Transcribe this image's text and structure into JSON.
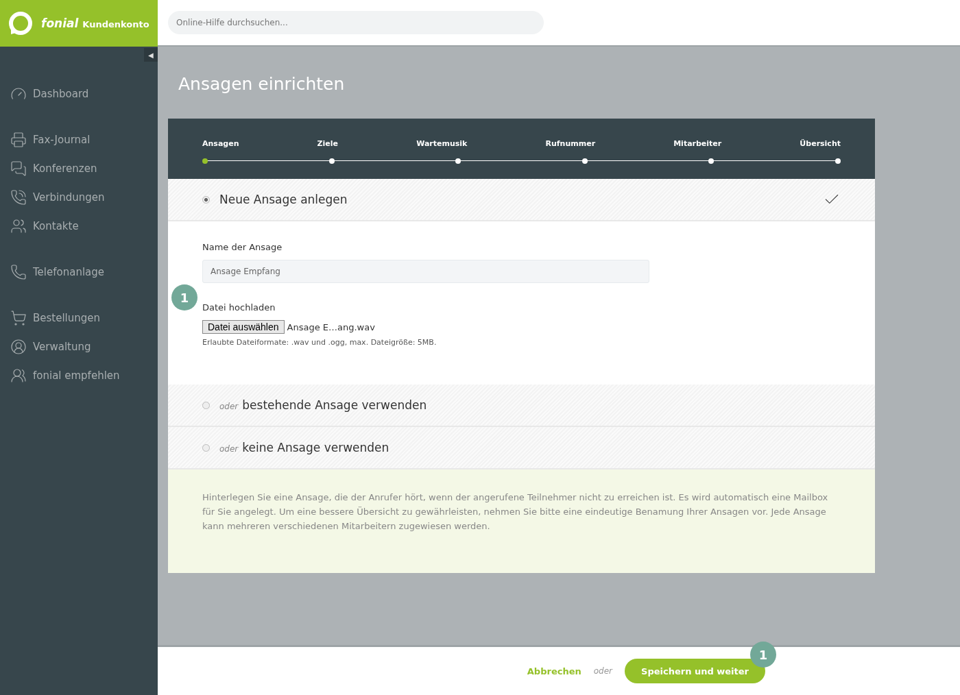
{
  "brand": {
    "name": "fonial",
    "product": "Kundenkonto"
  },
  "search": {
    "placeholder": "Online-Hilfe durchsuchen..."
  },
  "sidebar": {
    "collapse": "◀",
    "groups": [
      [
        {
          "label": "Dashboard"
        }
      ],
      [
        {
          "label": "Fax-Journal"
        },
        {
          "label": "Konferenzen"
        },
        {
          "label": "Verbindungen"
        },
        {
          "label": "Kontakte"
        }
      ],
      [
        {
          "label": "Telefonanlage"
        }
      ],
      [
        {
          "label": "Bestellungen"
        },
        {
          "label": "Verwaltung"
        },
        {
          "label": "fonial empfehlen"
        }
      ]
    ]
  },
  "page_title": "Ansagen einrichten",
  "steps": [
    {
      "label": "Ansagen",
      "selected": true
    },
    {
      "label": "Ziele",
      "selected": false
    },
    {
      "label": "Wartemusik",
      "selected": false
    },
    {
      "label": "Rufnummer",
      "selected": false
    },
    {
      "label": "Mitarbeiter",
      "selected": false
    },
    {
      "label": "Übersicht",
      "selected": false
    }
  ],
  "options": [
    {
      "label": "Neue Ansage anlegen",
      "selected": true
    },
    {
      "prefix": "oder",
      "label": "bestehende Ansage verwenden",
      "selected": false
    },
    {
      "prefix": "oder",
      "label": "keine Ansage verwenden",
      "selected": false
    }
  ],
  "form": {
    "name_label": "Name der Ansage",
    "name_value": "Ansage Empfang",
    "upload_label": "Datei hochladen",
    "file_button": "Datei auswählen",
    "file_name": "Ansage E…ang.wav",
    "hint": "Erlaubte Dateiformate: .wav und .ogg, max. Dateigröße: 5MB."
  },
  "info": "Hinterlegen Sie eine Ansage, die der Anrufer hört, wenn der angerufene Teilnehmer nicht zu erreichen ist. Es wird automatisch eine Mailbox für Sie angelegt. Um eine bessere Übersicht zu gewährleisten, nehmen Sie bitte eine eindeutige Benamung Ihrer Ansagen vor. Jede Ansage kann mehreren verschiedenen Mitarbeitern zugewiesen werden.",
  "footer": {
    "cancel": "Abbrechen",
    "or": "oder",
    "submit": "Speichern und weiter"
  },
  "markers": [
    "1",
    "1"
  ]
}
